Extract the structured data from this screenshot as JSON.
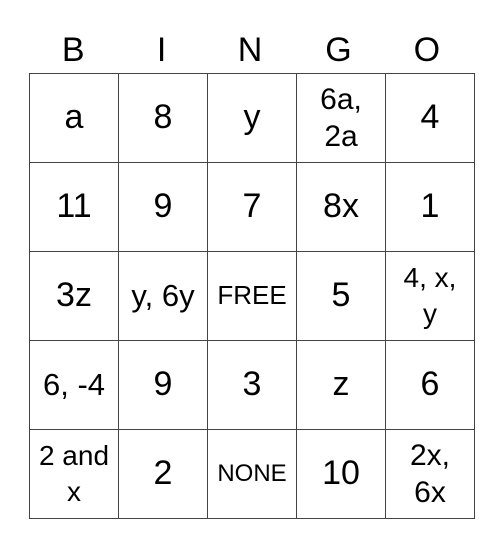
{
  "header": [
    "B",
    "I",
    "N",
    "G",
    "O"
  ],
  "rows": [
    [
      "a",
      "8",
      "y",
      "6a,\n2a",
      "4"
    ],
    [
      "11",
      "9",
      "7",
      "8x",
      "1"
    ],
    [
      "3z",
      "y, 6y",
      "FREE",
      "5",
      "4, x,\ny"
    ],
    [
      "6, -4",
      "9",
      "3",
      "z",
      "6"
    ],
    [
      "2 and\nx",
      "2",
      "NONE",
      "10",
      "2x,\n6x"
    ]
  ]
}
